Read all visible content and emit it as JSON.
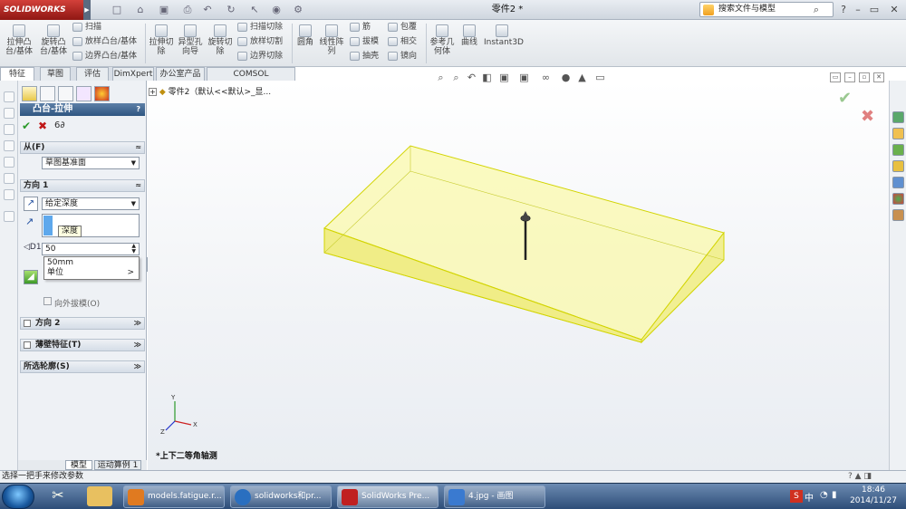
{
  "app": {
    "logo_text": "SOLIDWORKS",
    "document_title": "零件2 *"
  },
  "search": {
    "placeholder": "搜索文件与模型"
  },
  "ribbon": {
    "big_buttons": [
      "拉伸凸台/基体",
      "旋转凸台/基体",
      "拉伸切除",
      "异型孔向导",
      "旋转切除"
    ],
    "col1": [
      "扫描",
      "放样凸台/基体",
      "边界凸台/基体"
    ],
    "col2": [
      "扫描切除",
      "放样切割",
      "边界切除"
    ],
    "fillet": "圆角",
    "pattern": "线性阵列",
    "col3": [
      "筋",
      "拔模",
      "抽壳"
    ],
    "col4": [
      "包覆",
      "相交",
      "镜向"
    ],
    "ref_geom": "参考几何体",
    "curves": "曲线",
    "instant3d": "Instant3D"
  },
  "tabs": [
    "特征",
    "草图",
    "评估",
    "DimXpert",
    "办公室产品",
    "COMSOL Multiphysics"
  ],
  "pm": {
    "title": "凸台-拉伸",
    "ok": "✔",
    "cancel": "✖",
    "preview": "6∂",
    "from_label": "从(F)",
    "from_value": "草图基准面",
    "dir1_label": "方向 1",
    "end_condition": "给定深度",
    "tooltip": "深度",
    "depth_value": "50",
    "suggest_value": "50mm",
    "suggest_unit": "单位",
    "draft_outward": "向外拔模(O)",
    "dir2_label": "方向 2",
    "thin_label": "薄壁特征(T)",
    "contours_label": "所选轮廓(S)"
  },
  "tree": {
    "root": "零件2（默认<<默认>_显..."
  },
  "viewport": {
    "view_label": "*上下二等角轴测"
  },
  "bottom_tabs": [
    "模型",
    "运动算例 1"
  ],
  "status": {
    "text": "选择一把手来修改参数"
  },
  "taskbar": {
    "items": [
      {
        "label": "models.fatigue.r...",
        "color": "#e07a20"
      },
      {
        "label": "solidworks和pr...",
        "color": "#2a6fc0"
      },
      {
        "label": "SolidWorks Pre...",
        "color": "#c02020"
      },
      {
        "label": "4.jpg - 画图",
        "color": "#3a7ad0"
      }
    ],
    "time": "18:46",
    "date": "2014/11/27",
    "ime": "中"
  },
  "colors": {
    "accent": "#2f5681",
    "part_fill": "#fbfaa6",
    "part_edge": "#d2d400"
  }
}
